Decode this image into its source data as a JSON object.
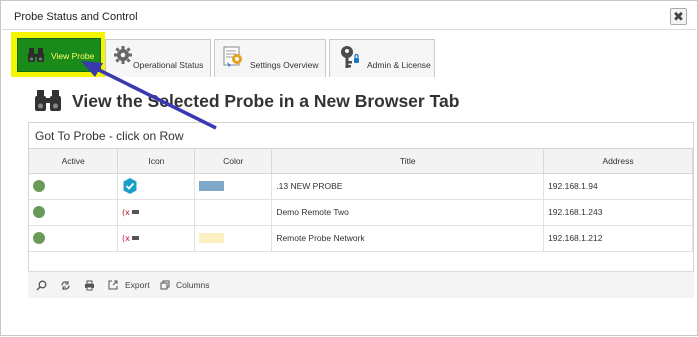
{
  "window": {
    "title": "Probe Status and Control",
    "close_label": "✖"
  },
  "tabs": [
    {
      "label": "View Probe",
      "icon": "binoculars-icon",
      "active": true
    },
    {
      "label": "Operational Status",
      "icon": "gear-icon"
    },
    {
      "label": "Settings Overview",
      "icon": "settings-overview-icon"
    },
    {
      "label": "Admin & License",
      "icon": "key-icon"
    }
  ],
  "heading": "View the Selected Probe in a New Browser Tab",
  "grid": {
    "caption": "Got To Probe - click on Row",
    "columns": [
      "Active",
      "Icon",
      "Color",
      "Title",
      "Address"
    ],
    "rows": [
      {
        "active": true,
        "icon": "check-badge-icon",
        "color": "#7ea7c8",
        "title": ".13 NEW PROBE",
        "address": "192.168.1.94"
      },
      {
        "active": true,
        "icon": "remote-probe-icon",
        "color": "",
        "title": "Demo Remote Two",
        "address": "192.168.1.243"
      },
      {
        "active": true,
        "icon": "remote-probe-icon",
        "color": "#fbf0c4",
        "title": "Remote Probe Network",
        "address": "192.168.1.212"
      }
    ]
  },
  "toolbar": {
    "search_icon": "search-icon",
    "refresh_icon": "refresh-icon",
    "print_icon": "print-icon",
    "export_label": "Export",
    "columns_label": "Columns"
  },
  "colors": {
    "active_tab": "#1a8b1a",
    "active_tab_text": "#ffff66",
    "highlight": "#f5f500",
    "annotation_arrow": "#3a3ab0",
    "status_green": "#6a9a59"
  }
}
